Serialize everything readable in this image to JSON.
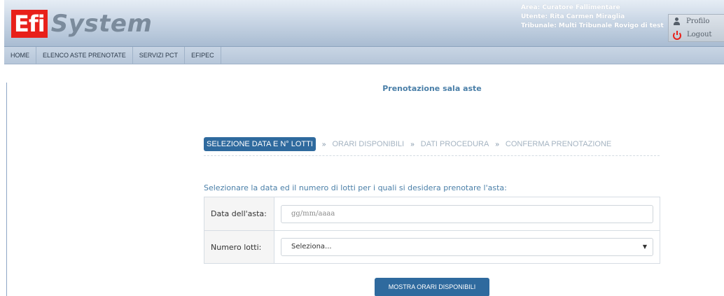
{
  "header": {
    "logo_left": "Efi",
    "logo_right": "System",
    "area": "Area: Curatore Fallimentare",
    "utente": "Utente: Rita Carmen Miraglia",
    "tribunale": "Tribunale: Multi Tribunale Rovigo di test",
    "profilo_label": "Profilo",
    "logout_label": "Logout"
  },
  "nav": {
    "items": [
      "HOME",
      "ELENCO ASTE PRENOTATE",
      "SERVIZI PCT",
      "EFIPEC"
    ]
  },
  "main": {
    "title": "Prenotazione sala aste",
    "steps": [
      "SELEZIONE DATA E N° LOTTI",
      "ORARI DISPONIBILI",
      "DATI PROCEDURA",
      "CONFERMA PRENOTAZIONE"
    ],
    "separator": "»",
    "instruction": "Selezionare la data ed il numero di lotti per i quali si desidera prenotare l'asta:",
    "form": {
      "date_label": "Data dell'asta:",
      "date_placeholder": "gg/mm/aaaa",
      "lots_label": "Numero lotti:",
      "lots_selected": "Seleziona..."
    },
    "submit_label": "MOSTRA ORARI DISPONIBILI"
  },
  "colors": {
    "brand_red": "#e8201a",
    "accent_blue": "#2f6a9e",
    "title_blue": "#4a7fa8",
    "inactive_step": "#a5b4c2"
  },
  "icons": {
    "profile": "person-icon",
    "logout": "power-icon",
    "select_caret": "caret-down-icon"
  }
}
